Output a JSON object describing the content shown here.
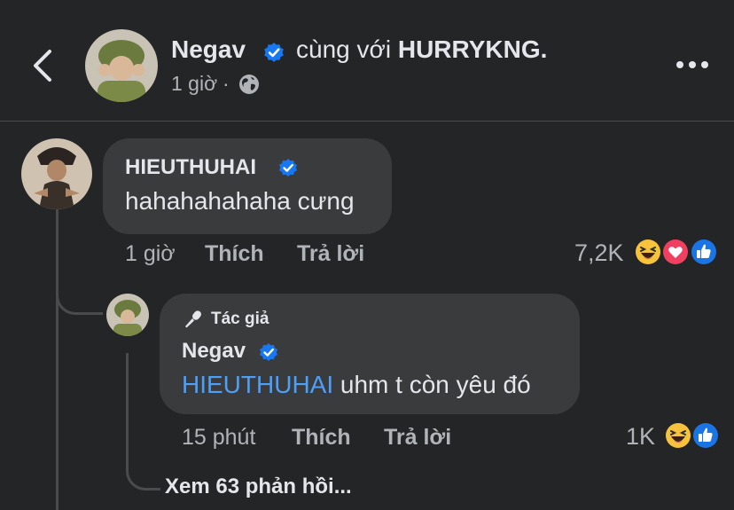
{
  "header": {
    "poster_name": "Negav",
    "with_text": "cùng với",
    "tagged_name": "HURRYKNG.",
    "time": "1 giờ",
    "separator": "·",
    "privacy_icon": "globe-icon",
    "back_icon": "chevron-left-icon",
    "more_icon": "more-horizontal-icon"
  },
  "comment": {
    "author": "HIEUTHUHAI",
    "text": "hahahahahaha cưng",
    "time": "1 giờ",
    "like_label": "Thích",
    "reply_label": "Trả lời",
    "reaction_count": "7,2K",
    "reactions": [
      "haha-icon",
      "love-icon",
      "like-icon"
    ]
  },
  "reply": {
    "author_badge": "Tác giả",
    "author": "Negav",
    "mention": "HIEUTHUHAI",
    "text": " uhm t còn yêu đó",
    "time": "15 phút",
    "like_label": "Thích",
    "reply_label": "Trả lời",
    "reaction_count": "1K",
    "reactions": [
      "haha-icon",
      "like-icon"
    ]
  },
  "view_more_replies": "Xem 63 phản hồi...",
  "colors": {
    "background": "#242526",
    "bubble": "#3a3b3c",
    "verified": "#1877f2",
    "mention": "#4e9ff7",
    "secondary_text": "#b0b3b8"
  }
}
